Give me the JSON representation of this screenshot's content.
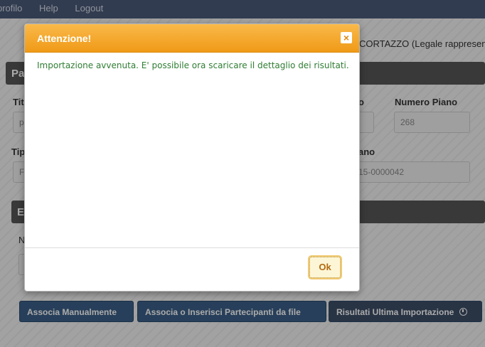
{
  "topbar": {
    "menu": [
      "profilo",
      "Help",
      "Logout"
    ]
  },
  "page": {
    "user_info": "CORTAZZO (Legale rappresent",
    "section1_label": "Pa",
    "section2_label": "E",
    "labels": {
      "tit": "Tit",
      "tip": "Tip",
      "o": "o",
      "numero_piano": "Numero Piano",
      "ano": "ano",
      "n": "N"
    },
    "values": {
      "f1": "p",
      "f2": "F",
      "numero_piano": "268",
      "codice": "15-0000042"
    },
    "buttons": {
      "associa_manualmente": "Associa Manualmente",
      "associa_file": "Associa o Inserisci Partecipanti da file",
      "risultati": "Risultati Ultima Importazione"
    }
  },
  "modal": {
    "title": "Attenzione!",
    "close_glyph": "×",
    "message": "Importazione avvenuta. E' possibile ora scaricare il dettaglio dei risultati.",
    "ok_label": "Ok"
  },
  "colors": {
    "header_orange": "#f09a17",
    "message_green": "#2f7d32",
    "primary_button": "#3b5e86"
  }
}
